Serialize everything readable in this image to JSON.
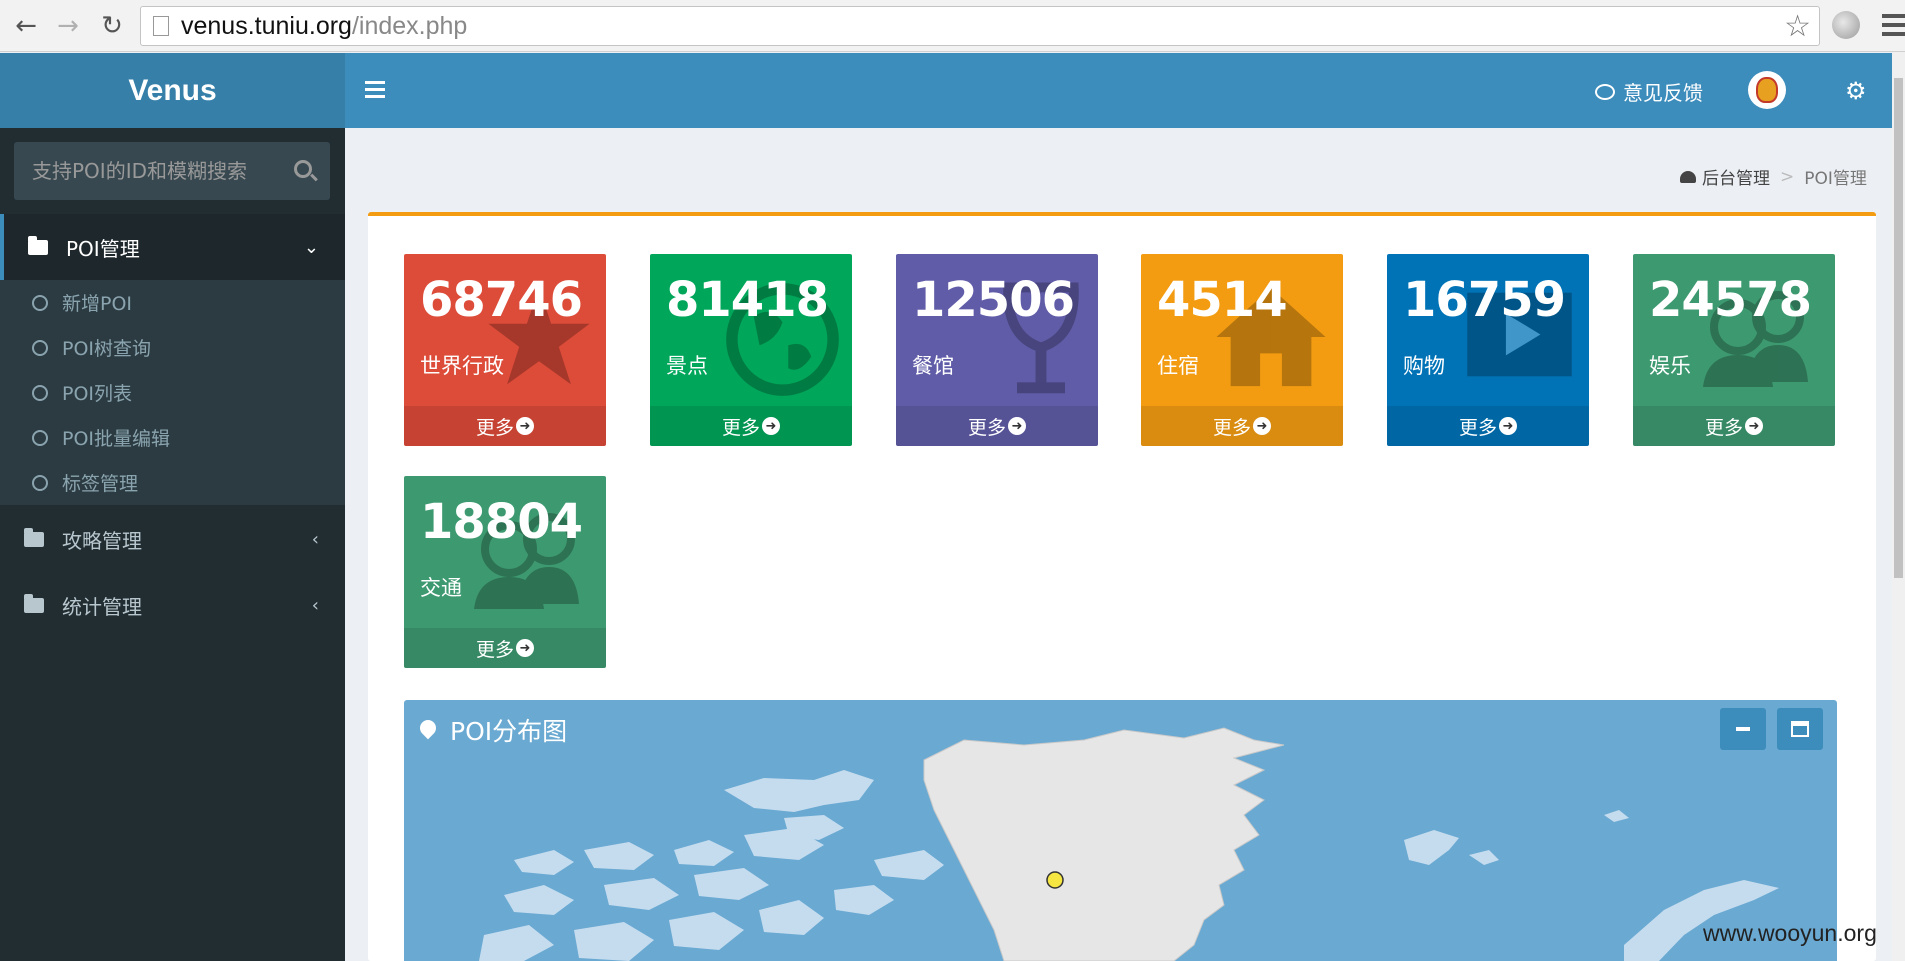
{
  "browser": {
    "url_host": "venus.tuniu.org",
    "url_path": "/index.php"
  },
  "app": {
    "logo": "Venus",
    "feedback_label": "意见反馈"
  },
  "sidebar": {
    "search_placeholder": "支持POI的ID和模糊搜索",
    "menu": [
      {
        "label": "POI管理",
        "expanded": true
      },
      {
        "label": "攻略管理",
        "expanded": false
      },
      {
        "label": "统计管理",
        "expanded": false
      }
    ],
    "submenu": [
      "新增POI",
      "POI树查询",
      "POI列表",
      "POI批量编辑",
      "标签管理"
    ]
  },
  "breadcrumb": {
    "home": "后台管理",
    "sep": ">",
    "current": "POI管理"
  },
  "tiles": [
    {
      "value": "68746",
      "label": "世界行政",
      "more": "更多",
      "color": "#dd4b39",
      "icon": "star-icon"
    },
    {
      "value": "81418",
      "label": "景点",
      "more": "更多",
      "color": "#00a65a",
      "icon": "globe-icon"
    },
    {
      "value": "12506",
      "label": "餐馆",
      "more": "更多",
      "color": "#605ca8",
      "icon": "glass-icon"
    },
    {
      "value": "4514",
      "label": "住宿",
      "more": "更多",
      "color": "#f39c12",
      "icon": "home-icon"
    },
    {
      "value": "16759",
      "label": "购物",
      "more": "更多",
      "color": "#0073b7",
      "icon": "video-icon"
    },
    {
      "value": "24578",
      "label": "娱乐",
      "more": "更多",
      "color": "#3d9970",
      "icon": "users-icon"
    },
    {
      "value": "18804",
      "label": "交通",
      "more": "更多",
      "color": "#3d9970",
      "icon": "users-icon"
    }
  ],
  "map": {
    "title": "POI分布图",
    "color": "#6aa9d2",
    "marker_color": "#f5e642"
  },
  "watermark": "www.wooyun.org"
}
